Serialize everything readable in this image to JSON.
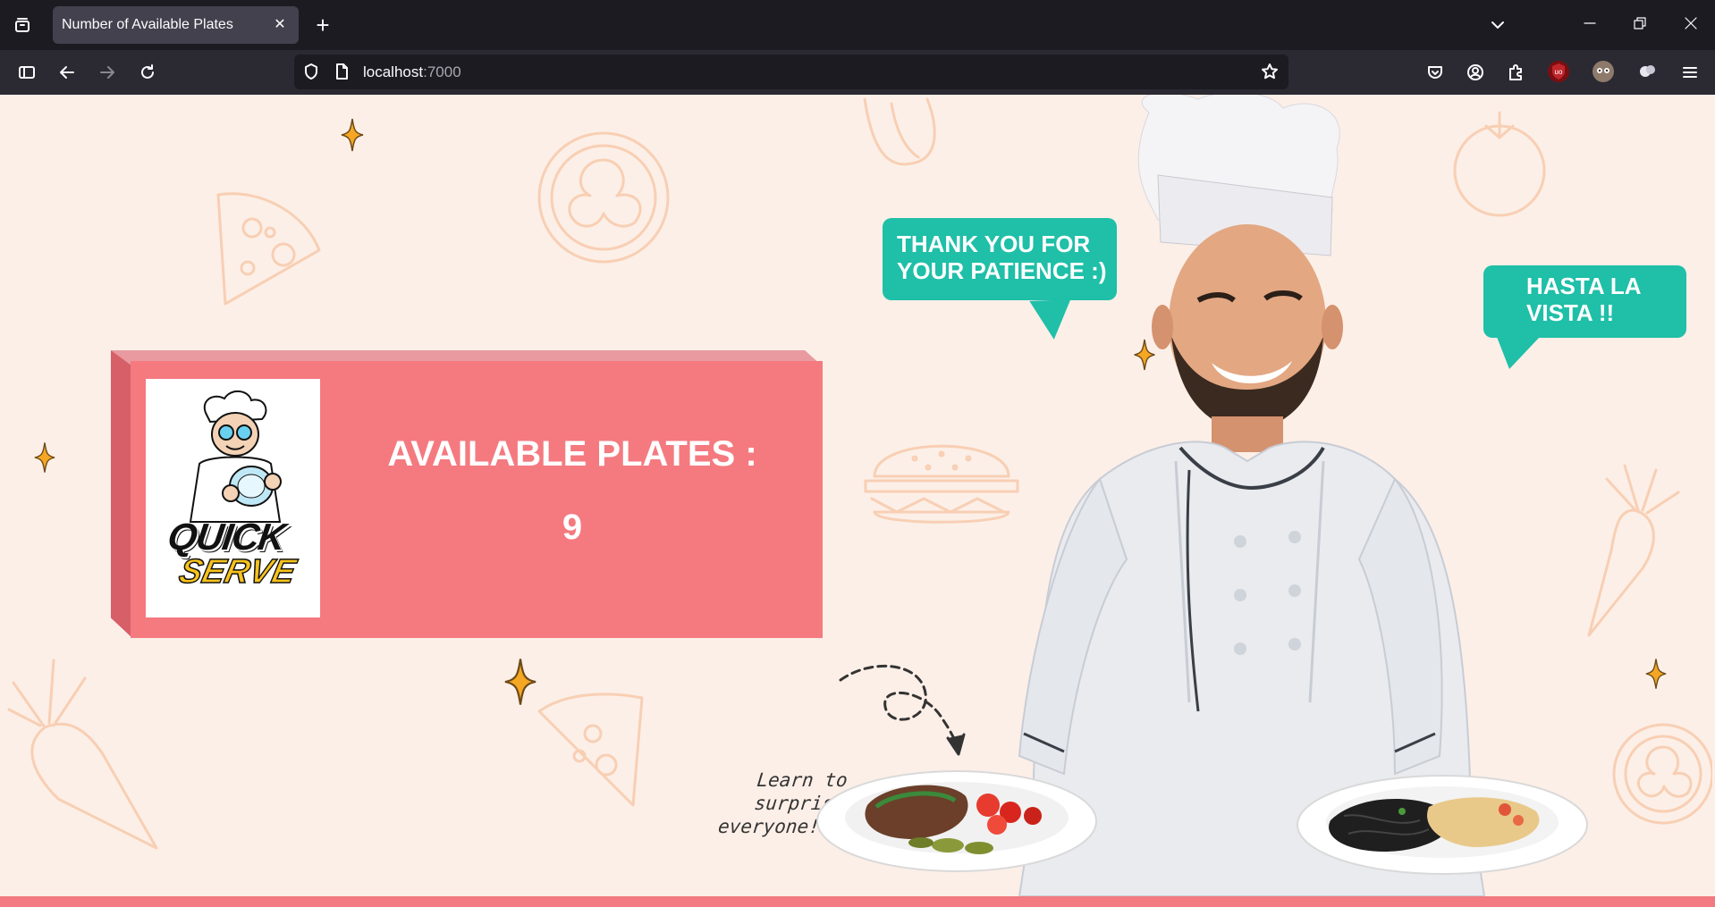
{
  "browser": {
    "tab_title": "Number of Available Plates",
    "url_host": "localhost",
    "url_port": ":7000"
  },
  "page": {
    "available_label": "AVAILABLE PLATES :",
    "available_count": "9",
    "logo": {
      "line1": "QUICK",
      "line2": "SERVE"
    },
    "bubble_left": {
      "line1": "THANK YOU FOR",
      "line2": "YOUR PATIENCE :)"
    },
    "bubble_right": {
      "line1": "HASTA LA",
      "line2": "VISTA !!"
    },
    "note": {
      "line1": "Learn to surprise",
      "line2": "everyone!!!"
    }
  },
  "colors": {
    "background": "#fcefe7",
    "box": "#f47a80",
    "bubble": "#1fbfa8",
    "sparkle": "#f5a623"
  },
  "icons": [
    "tab-list-icon",
    "close-icon",
    "new-tab-icon",
    "chevron-down-icon",
    "minimize-icon",
    "restore-icon",
    "window-close-icon",
    "sidebar-icon",
    "back-icon",
    "forward-icon",
    "reload-icon",
    "shield-icon",
    "page-icon",
    "star-icon",
    "pocket-icon",
    "account-icon",
    "extensions-icon",
    "ublock-icon",
    "avatar-icon",
    "extension-puzzle-icon",
    "menu-icon"
  ]
}
